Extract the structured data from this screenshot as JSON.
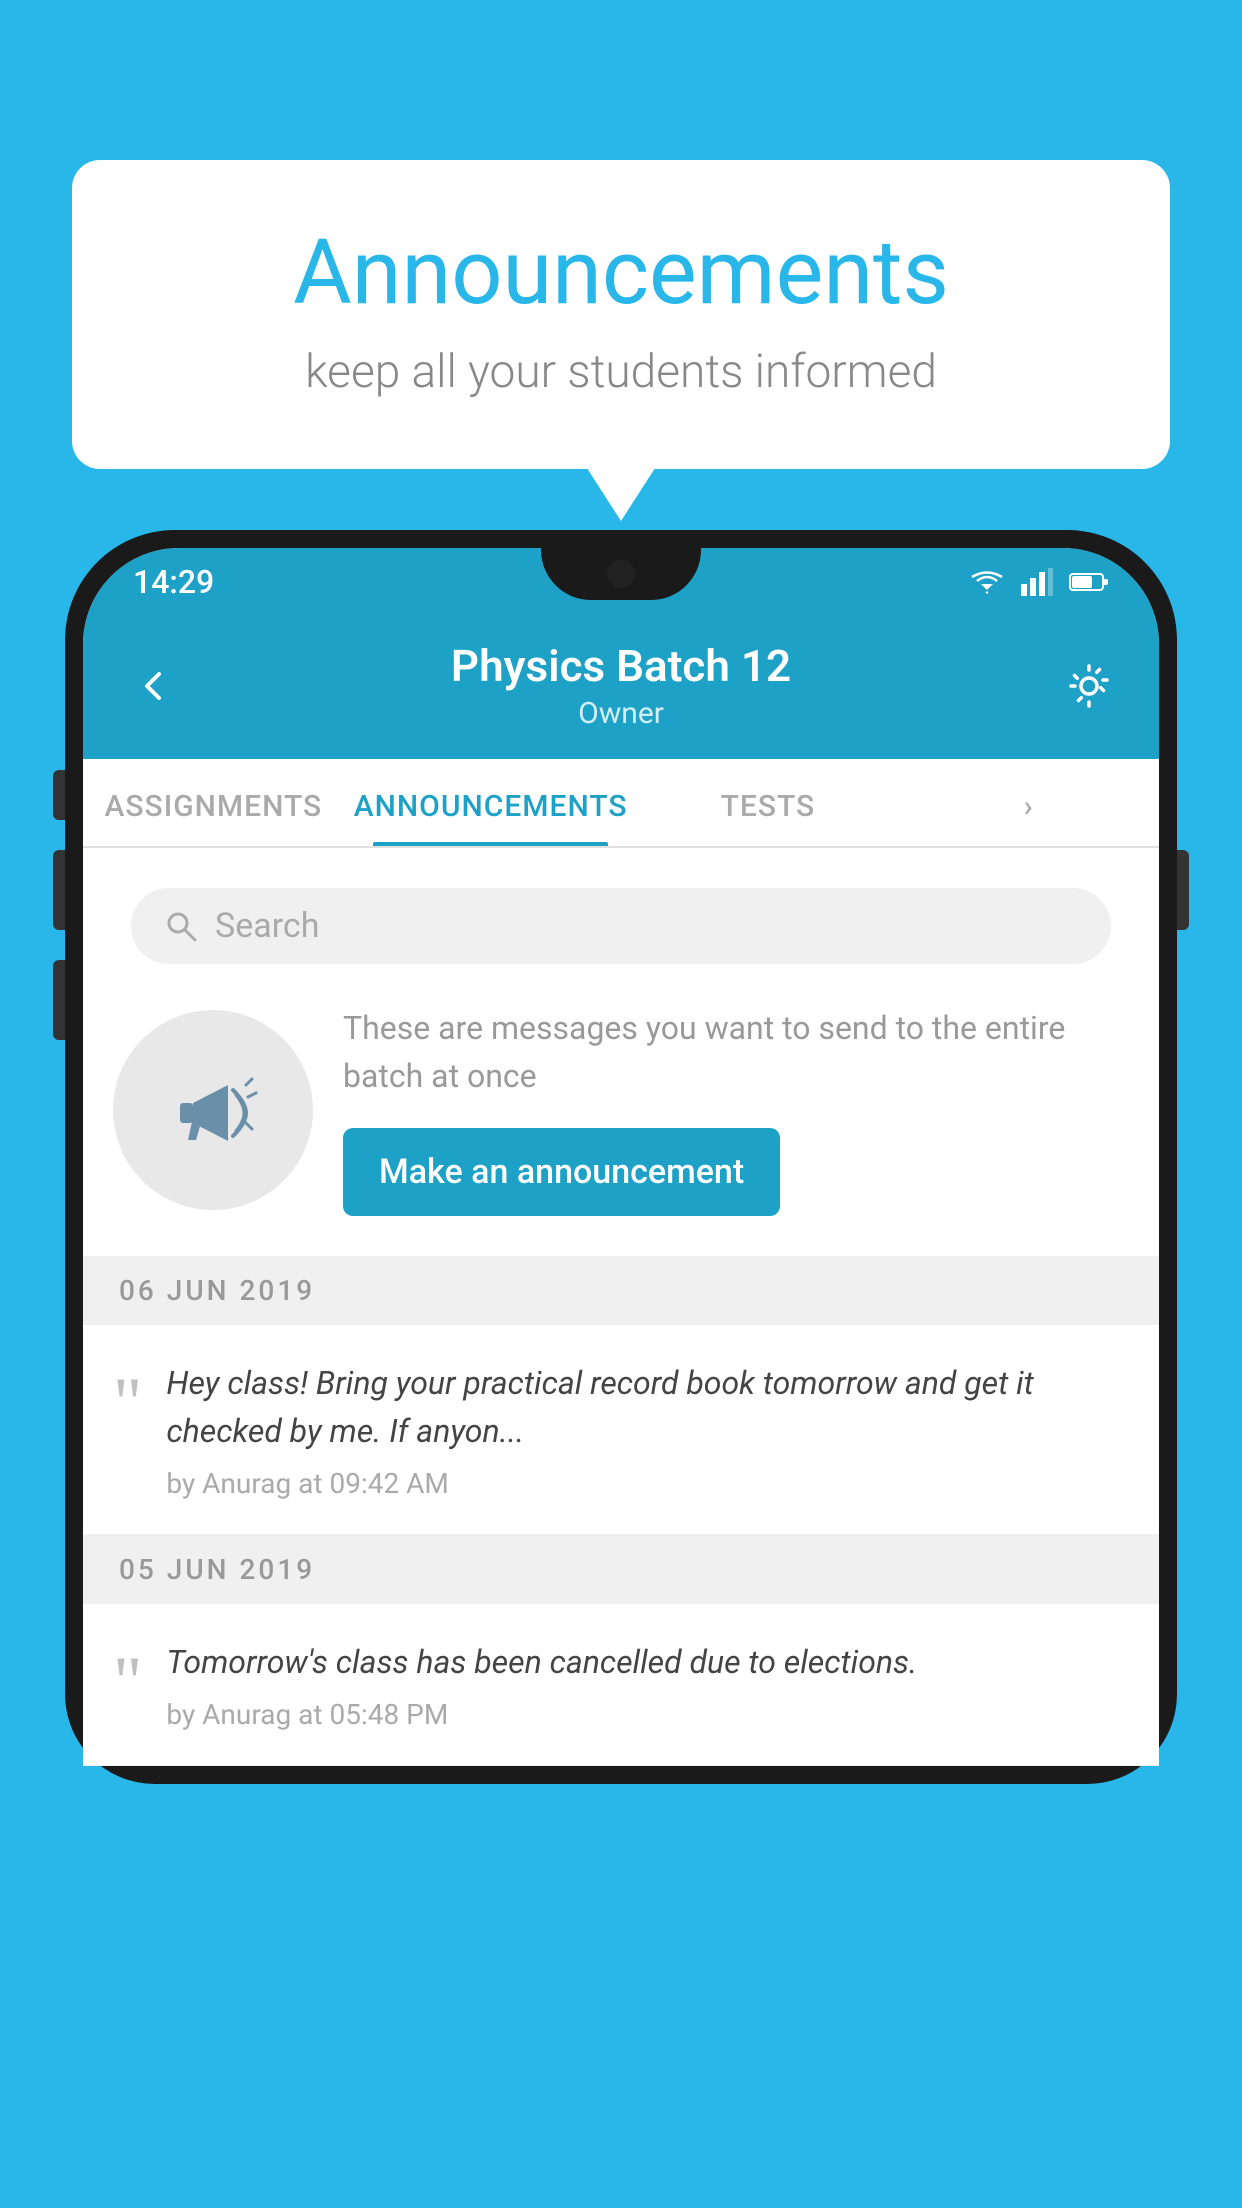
{
  "bubble": {
    "title": "Announcements",
    "subtitle": "keep all your students informed"
  },
  "status_bar": {
    "time": "14:29"
  },
  "header": {
    "title": "Physics Batch 12",
    "subtitle": "Owner",
    "back_label": "back",
    "gear_label": "settings"
  },
  "tabs": [
    {
      "label": "ASSIGNMENTS",
      "active": false
    },
    {
      "label": "ANNOUNCEMENTS",
      "active": true
    },
    {
      "label": "TESTS",
      "active": false
    },
    {
      "label": "MORE",
      "active": false
    }
  ],
  "search": {
    "placeholder": "Search"
  },
  "announce_promo": {
    "description": "These are messages you want to send to the entire batch at once",
    "button_label": "Make an announcement"
  },
  "announcements": [
    {
      "date": "06  JUN  2019",
      "message": "Hey class! Bring your practical record book tomorrow and get it checked by me. If anyon...",
      "meta": "by Anurag at 09:42 AM"
    },
    {
      "date": "05  JUN  2019",
      "message": "Tomorrow's class has been cancelled due to elections.",
      "meta": "by Anurag at 05:48 PM"
    }
  ],
  "colors": {
    "primary": "#1da1c7",
    "background": "#29b6e8",
    "white": "#ffffff"
  }
}
